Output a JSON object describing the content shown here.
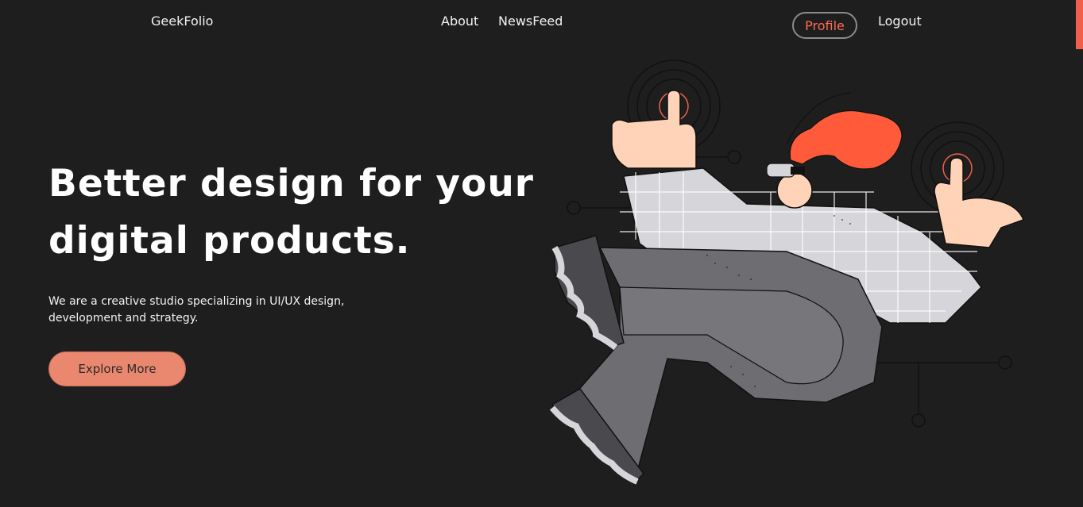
{
  "nav": {
    "brand": "GeekFolio",
    "links": [
      "About",
      "NewsFeed"
    ],
    "profile": "Profile",
    "logout": "Logout"
  },
  "hero": {
    "title_lines": [
      "Better design for your",
      "digital products."
    ],
    "subtitle_lines": [
      "We are a creative studio specializing in UI/UX design,",
      "development and strategy."
    ],
    "cta": "Explore More"
  },
  "colors": {
    "background": "#1e1e1e",
    "accent": "#ef5f4a",
    "cta": "#e9876f",
    "hair": "#ff5a3a"
  },
  "illustration": {
    "name": "vr-person-illustration"
  }
}
